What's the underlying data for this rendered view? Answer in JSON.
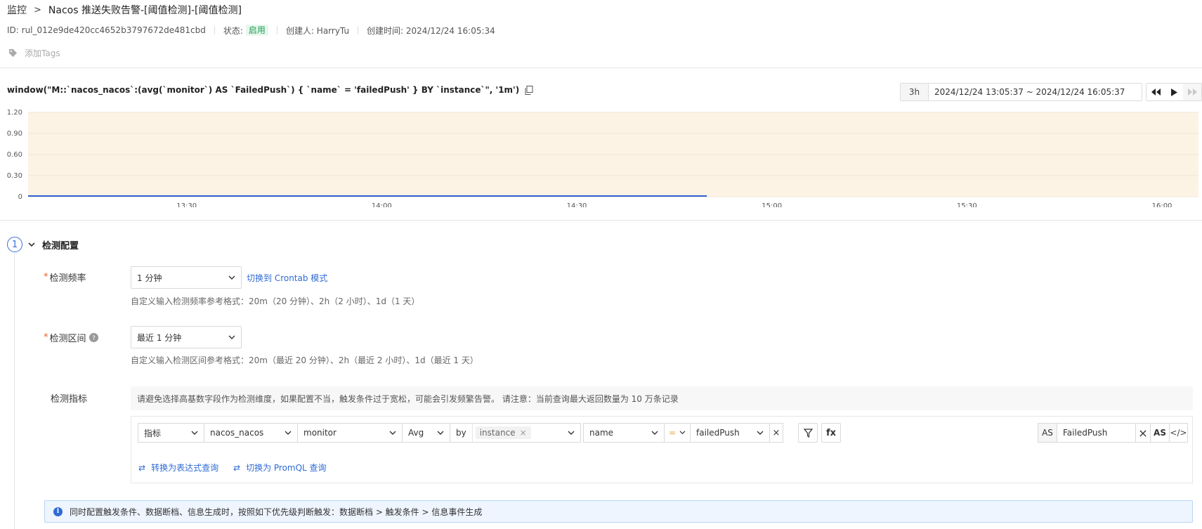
{
  "breadcrumb": {
    "root": "监控",
    "title": "Nacos 推送失败告警-[阈值检测]-[阈值检测]"
  },
  "meta": {
    "id": "ID: rul_012e9de420cc4652b3797672de481cbd",
    "status_label": "状态:",
    "status_value": "启用",
    "creator": "创建人: HarryTu",
    "created_at": "创建时间: 2024/12/24 16:05:34"
  },
  "tags": {
    "add_label": "添加Tags"
  },
  "query": {
    "text": "window(\"M::`nacos_nacos`:(avg(`monitor`) AS `FailedPush`) { `name` = 'failedPush' } BY `instance`\", '1m')"
  },
  "time": {
    "range": "3h",
    "value": "2024/12/24 13:05:37 ~ 2024/12/24 16:05:37"
  },
  "colors": {
    "accent": "#2f6bd6",
    "chart_bg": "#fdf3e4",
    "series": "#2f5fd0",
    "required": "#e8612a"
  },
  "chart_data": {
    "type": "line",
    "y_ticks": [
      "1.20",
      "0.90",
      "0.60",
      "0.30",
      "0"
    ],
    "x_ticks": [
      "13:30",
      "14:00",
      "14:30",
      "15:00",
      "15:30",
      "16:00"
    ],
    "ylim": [
      0,
      1.2
    ],
    "series": [
      {
        "x_start": "13:05",
        "x_end": "14:50",
        "value": 0
      }
    ]
  },
  "section": {
    "step": "1",
    "title": "检测配置"
  },
  "freq": {
    "label": "检测频率",
    "value": "1 分钟",
    "switch_link": "切换到 Crontab 模式",
    "hint": "自定义输入检测频率参考格式：20m（20 分钟）、2h（2 小时）、1d（1 天）"
  },
  "interval": {
    "label": "检测区间",
    "value": "最近 1 分钟",
    "hint": "自定义输入检测区间参考格式：20m（最近 20 分钟）、2h（最近 2 小时）、1d（最近 1 天）"
  },
  "metric": {
    "label": "检测指标",
    "warning": "请避免选择高基数字段作为检测维度，如果配置不当，触发条件过于宽松，可能会引发频繁告警。 请注意：当前查询最大返回数量为 10 万条记录",
    "type": "指标",
    "measurement": "nacos_nacos",
    "field": "monitor",
    "agg": "Avg",
    "by": "by",
    "group": "instance",
    "filter_key": "name",
    "filter_op": "=",
    "filter_value": "failedPush",
    "filter_btn": "▼",
    "fx": "fx",
    "as_label": "AS",
    "alias": "FailedPush",
    "as_btn": "AS",
    "code_btn": "</>",
    "to_expression": "转换为表达式查询",
    "to_promql": "切换为 PromQL 查询"
  },
  "info": {
    "text": "同时配置触发条件、数据断档、信息生成时，按照如下优先级判断触发：数据断档 > 触发条件 > 信息事件生成"
  }
}
